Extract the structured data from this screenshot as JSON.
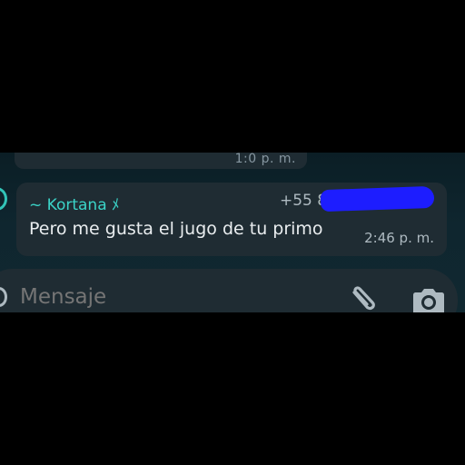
{
  "previous_message": {
    "time": "1:0 p. m."
  },
  "message": {
    "sender": "~ Kortana ﾒ",
    "phone": "+55 88 ···  ··· 8",
    "phone_redacted": true,
    "text": "Pero me gusta el jugo de tu primo",
    "time": "2:46 p. m."
  },
  "composer": {
    "placeholder": "Mensaje",
    "emoji_icon": "emoji-icon",
    "attach_icon": "paperclip-icon",
    "camera_icon": "camera-icon"
  },
  "colors": {
    "bubble": "#1f2c33",
    "sender": "#3bd4c8",
    "redaction": "#1d1dff",
    "background": "#0e242c"
  }
}
